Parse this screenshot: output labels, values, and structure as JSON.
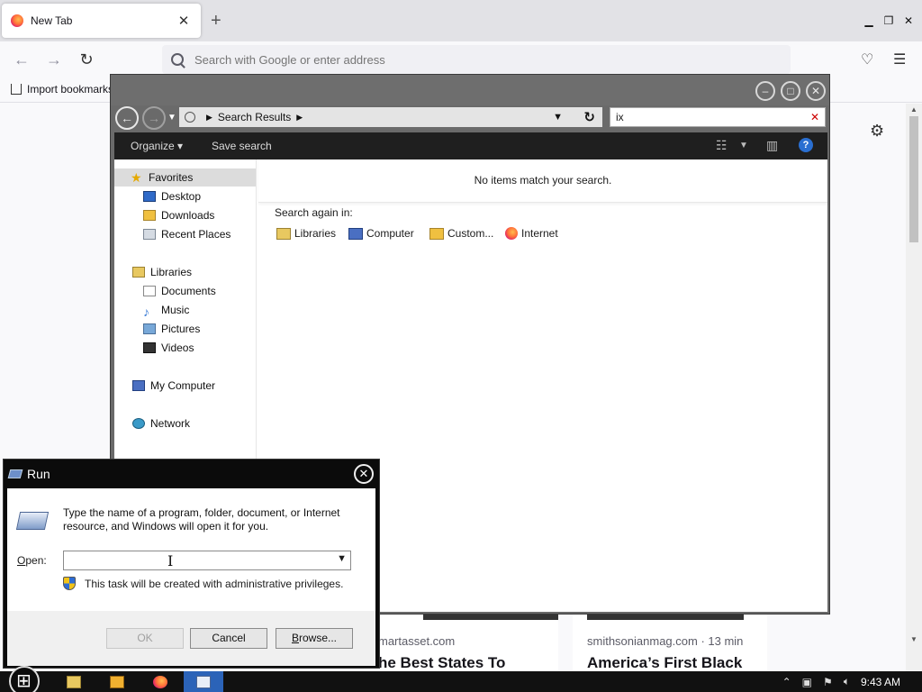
{
  "firefox": {
    "tab_title": "New Tab",
    "tab_close": "✕",
    "new_tab": "+",
    "url_placeholder": "Search with Google or enter address",
    "import_bookmarks": "Import bookmarks...",
    "cards": [
      {
        "source": "martasset.com",
        "headline": "he Best States To"
      },
      {
        "source": "smithsonianmag.com · 13 min",
        "headline": "America’s First Black"
      }
    ]
  },
  "explorer": {
    "breadcrumb": "Search Results",
    "search_value": "ix",
    "toolbar": {
      "organize": "Organize",
      "save_search": "Save search"
    },
    "nav": {
      "favorites": "Favorites",
      "favorites_items": [
        "Desktop",
        "Downloads",
        "Recent Places"
      ],
      "libraries": "Libraries",
      "library_items": [
        "Documents",
        "Music",
        "Pictures",
        "Videos"
      ],
      "computer": "My Computer",
      "network": "Network"
    },
    "no_items": "No items match your search.",
    "search_again_label": "Search again in:",
    "search_again": [
      "Libraries",
      "Computer",
      "Custom...",
      "Internet"
    ]
  },
  "run": {
    "title": "Run",
    "description": "Type the name of a program, folder, document, or Internet resource, and Windows will open it for you.",
    "open_label_underlined": "O",
    "open_label_rest": "pen:",
    "open_value": "",
    "admin_note": "This task will be created with administrative privileges.",
    "ok": "OK",
    "cancel": "Cancel",
    "browse_underlined": "B",
    "browse_rest": "rowse..."
  },
  "taskbar": {
    "clock": "9:43 AM"
  }
}
